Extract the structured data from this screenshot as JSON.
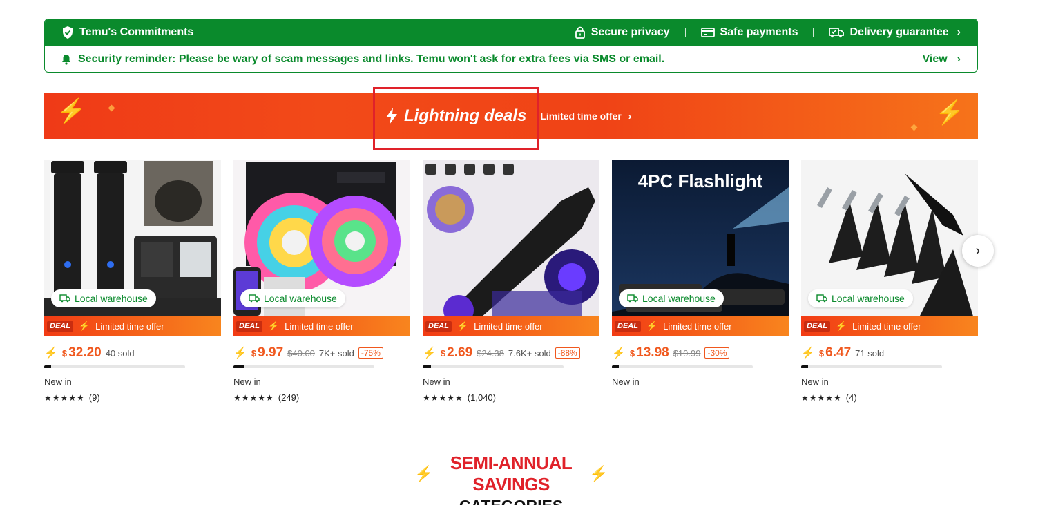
{
  "commitments": {
    "title": "Temu's Commitments",
    "items": [
      {
        "label": "Secure privacy",
        "icon": "lock-icon"
      },
      {
        "label": "Safe payments",
        "icon": "card-icon"
      },
      {
        "label": "Delivery guarantee",
        "icon": "truck-icon"
      }
    ],
    "reminder": "Security reminder: Please be wary of scam messages and links. Temu won't ask for extra fees via SMS or email.",
    "view_label": "View"
  },
  "banner": {
    "title": "Lightning deals",
    "subtitle": "Limited time offer"
  },
  "products": [
    {
      "price": "32.20",
      "currency": "$",
      "original": "",
      "sold": "40 sold",
      "discount": "",
      "progress": 0.05,
      "tag": "New in",
      "rating_count": "(9)",
      "stars": "★★★★★",
      "warehouse": "Local warehouse",
      "deal": "Limited time offer",
      "deal_logo": "DEAL"
    },
    {
      "price": "9.97",
      "currency": "$",
      "original": "$40.00",
      "sold": "7K+ sold",
      "discount": "-75%",
      "progress": 0.08,
      "tag": "New in",
      "rating_count": "(249)",
      "stars": "★★★★★",
      "warehouse": "Local warehouse",
      "deal": "Limited time offer",
      "deal_logo": "DEAL"
    },
    {
      "price": "2.69",
      "currency": "$",
      "original": "$24.38",
      "sold": "7.6K+ sold",
      "discount": "-88%",
      "progress": 0.06,
      "tag": "New in",
      "rating_count": "(1,040)",
      "stars": "★★★★★",
      "warehouse": "Local warehouse",
      "deal": "Limited time offer",
      "deal_logo": "DEAL"
    },
    {
      "price": "13.98",
      "currency": "$",
      "original": "$19.99",
      "sold": "",
      "discount": "-30%",
      "progress": 0.05,
      "tag": "New in",
      "rating_count": "",
      "stars": "",
      "warehouse": "Local warehouse",
      "deal": "Limited time offer",
      "deal_logo": "DEAL"
    },
    {
      "price": "6.47",
      "currency": "$",
      "original": "",
      "sold": "71 sold",
      "discount": "",
      "progress": 0.05,
      "tag": "New in",
      "rating_count": "(4)",
      "stars": "★★★★★",
      "warehouse": "Local warehouse",
      "deal": "Limited time offer",
      "deal_logo": "DEAL"
    }
  ],
  "section": {
    "line1": "SEMI-ANNUAL SAVINGS",
    "line2": "CATEGORIES"
  },
  "colors": {
    "green": "#0a8a2c",
    "orange": "#f0581e",
    "red": "#e0222a"
  }
}
